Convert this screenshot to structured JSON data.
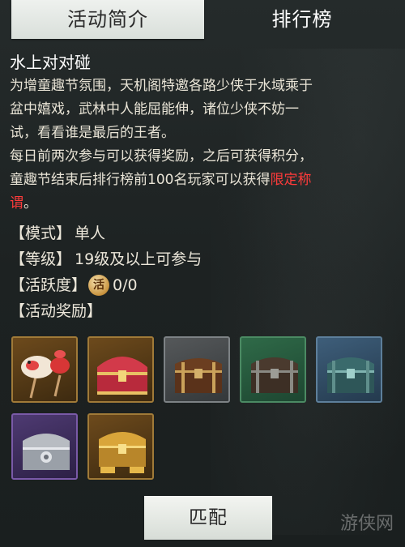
{
  "tabs": [
    {
      "label": "活动简介",
      "active": true
    },
    {
      "label": "排行榜",
      "active": false
    }
  ],
  "activity": {
    "title": "水上对对碰",
    "desc_lines": [
      "为增童趣节氛围，天机阁特邀各路少侠于水域乘于",
      "盆中嬉戏，武林中人能屈能伸，诸位少侠不妨一",
      "试，看看谁是最后的王者。",
      "每日前两次参与可以获得奖励，之后可获得积分，"
    ],
    "desc_line5_prefix": "童趣节结束后排行榜前100名玩家可以获得",
    "desc_highlight_a": "限定称",
    "desc_highlight_b": "谓",
    "desc_line6_suffix": "。"
  },
  "info": {
    "mode_label": "模式",
    "mode_value": "单人",
    "level_label": "等级",
    "level_value": "19级及以上可参与",
    "activity_label": "活跃度",
    "activity_icon_text": "活",
    "activity_value": "0/0",
    "rewards_label": "活动奖励",
    "open_bracket": "【",
    "close_bracket": "】"
  },
  "rewards": [
    {
      "icon": "fish-lantern-icon",
      "rarity_color": "#a07a38"
    },
    {
      "icon": "red-chest-icon",
      "rarity_color": "#a07a38"
    },
    {
      "icon": "brown-chest-icon",
      "rarity_color": "#7d8285"
    },
    {
      "icon": "dark-chest-icon",
      "rarity_color": "#4b8a63"
    },
    {
      "icon": "jade-chest-icon",
      "rarity_color": "#5d7f9b"
    },
    {
      "icon": "silver-chest-icon",
      "rarity_color": "#7a5aa8"
    },
    {
      "icon": "gold-chest-icon",
      "rarity_color": "#a07a38"
    }
  ],
  "match_button": "匹配",
  "watermark": "游侠网"
}
